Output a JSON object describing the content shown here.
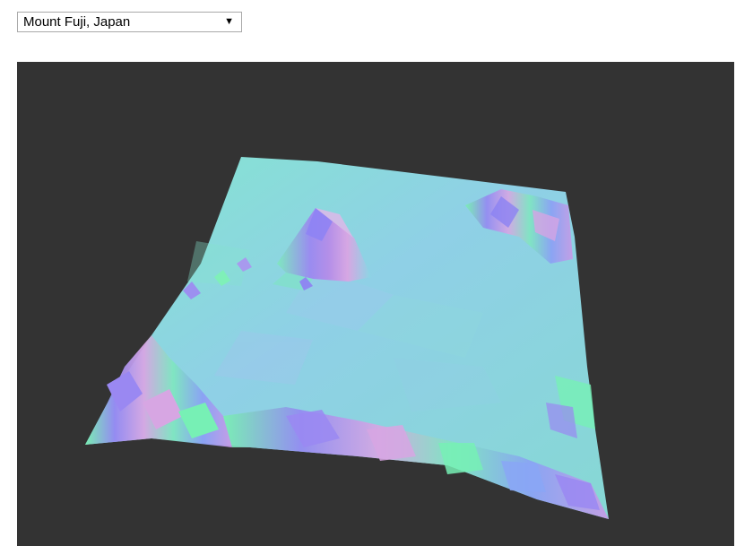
{
  "location_select": {
    "selected": "Mount Fuji, Japan",
    "chevron_icon": "triangle-down-icon"
  },
  "viewport": {
    "background": "#333333",
    "terrain_colors": {
      "plain": "#86d3de",
      "slope_green": "#77f0b5",
      "slope_violet": "#9a88f2",
      "slope_pink": "#d7a6e3",
      "ridge_blue": "#8aa6f6"
    }
  }
}
